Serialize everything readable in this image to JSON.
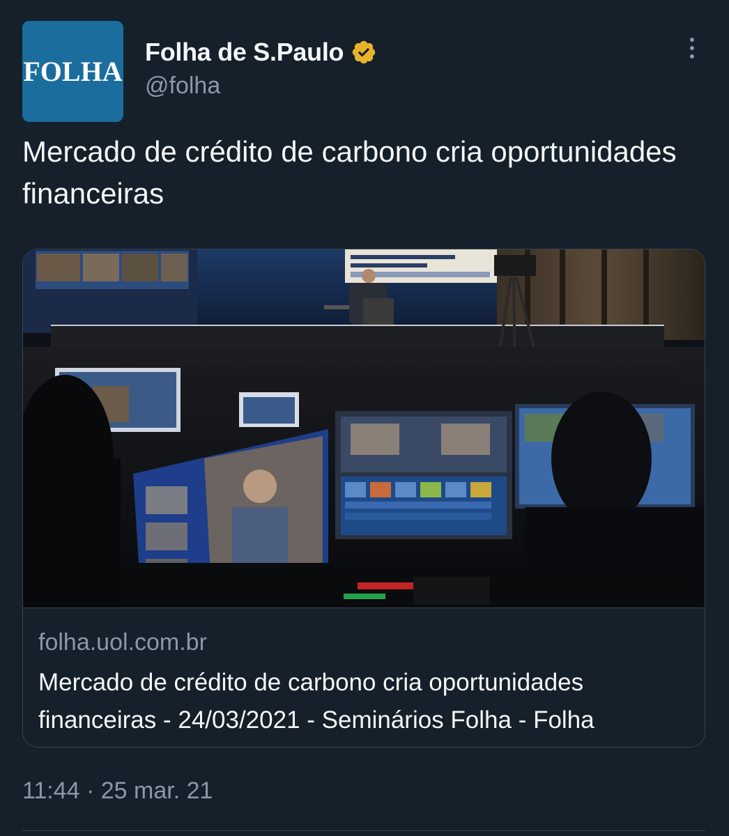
{
  "author": {
    "avatar_text": "FOLHA",
    "display_name": "Folha de S.Paulo",
    "handle": "@folha",
    "verified_icon": "verified-badge-icon",
    "more_icon": "more-vertical-icon"
  },
  "tweet": {
    "text": "Mercado de crédito de carbono cria oportunidades financeiras",
    "timestamp": "11:44 · 25 mar. 21"
  },
  "card": {
    "domain": "folha.uol.com.br",
    "title": "Mercado de crédito de carbono cria oportunidades financeiras - 24/03/2021 - Seminários Folha - Folha",
    "image_description_icon": "news-photo-image"
  },
  "colors": {
    "background": "#15202b",
    "secondary_text": "#8b98a5",
    "border": "#38444d",
    "avatar_bg": "#1b6d9e",
    "verified": "#e8b32c"
  }
}
